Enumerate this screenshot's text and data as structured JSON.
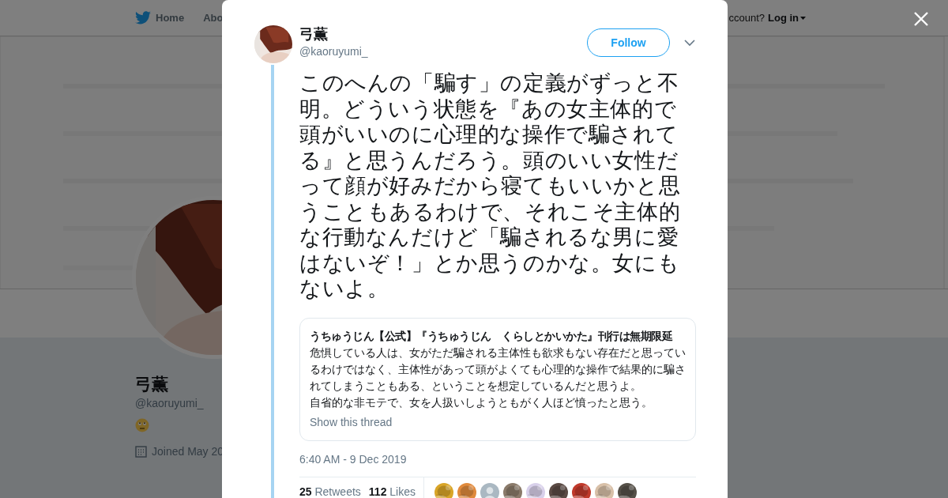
{
  "nav": {
    "items": [
      {
        "label": "Home"
      },
      {
        "label": "Abo"
      }
    ],
    "login_prompt": "ccount?",
    "login": "Log in"
  },
  "profile": {
    "name": "弓薫",
    "handle": "@kaoruyumi_",
    "joined": "Joined May 20"
  },
  "tweet": {
    "author": "弓薫",
    "handle": "@kaoruyumi_",
    "follow": "Follow",
    "text": "このへんの「騙す」の定義がずっと不明。どういう状態を『あの女主体的で頭がいいのに心理的な操作で騙されてる』と思うんだろう。頭のいい女性だって顔が好みだから寝てもいいかと思うこともあるわけで、それこそ主体的な行動なんだけど「騙されるな男に愛はないぞ！」とか思うのかな。女にもないよ。",
    "quote": {
      "author": "うちゅうじん【公式】『うちゅうじん　くらしとかいかた』刊行は無期限延",
      "paragraphs": [
        "危惧している人は、女がただ騙される主体性も欲求もない存在だと思っているわけではなく、主体性があって頭がよくても心理的な操作で結果的に騙されてしまうこともある、ということを想定しているんだと思うよ。",
        "自省的な非モテで、女を人扱いしようともがく人ほど憤ったと思う。"
      ],
      "link": "Show this thread"
    },
    "time": "6:40 AM - 9 Dec 2019",
    "stats": [
      {
        "count": "25",
        "label": "Retweets"
      },
      {
        "count": "112",
        "label": "Likes"
      }
    ]
  }
}
